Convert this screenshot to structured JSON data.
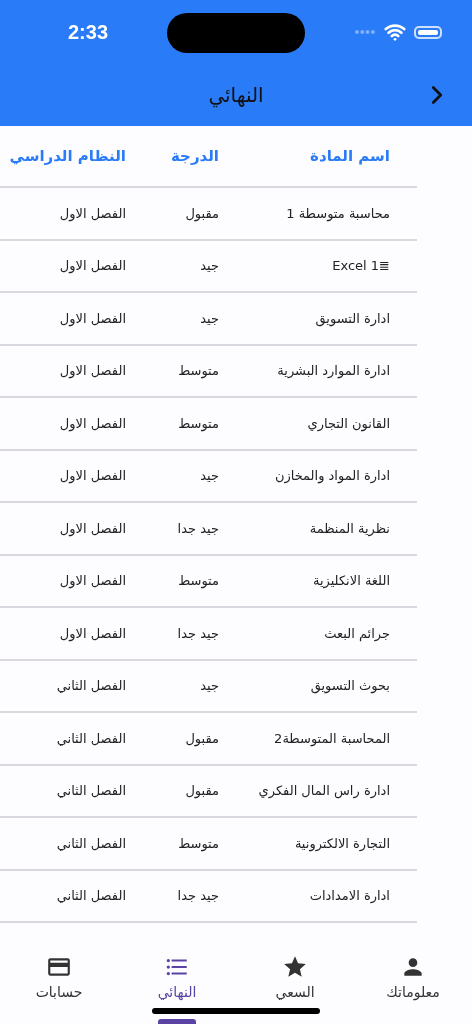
{
  "status_bar": {
    "time": "2:33"
  },
  "nav_bar": {
    "title": "النهائي"
  },
  "table": {
    "columns": [
      "اسم المادة",
      "الدرجة",
      "النظام الدراسي"
    ],
    "rows": [
      [
        "محاسبة متوسطة 1",
        "مقبول",
        "الفصل الاول"
      ],
      [
        "≣Excel 1",
        "جيد",
        "الفصل الاول"
      ],
      [
        "ادارة التسويق",
        "جيد",
        "الفصل الاول"
      ],
      [
        "ادارة الموارد البشرية",
        "متوسط",
        "الفصل الاول"
      ],
      [
        "القانون التجاري",
        "متوسط",
        "الفصل الاول"
      ],
      [
        "ادارة المواد والمخازن",
        "جيد",
        "الفصل الاول"
      ],
      [
        "نظرية المنظمة",
        "جيد جدا",
        "الفصل الاول"
      ],
      [
        "اللغة الانكليزية",
        "متوسط",
        "الفصل الاول"
      ],
      [
        "جرائم البعث",
        "جيد جدا",
        "الفصل الاول"
      ],
      [
        "بحوث التسويق",
        "جيد",
        "الفصل الثاني"
      ],
      [
        "المحاسبة المتوسطة2",
        "مقبول",
        "الفصل الثاني"
      ],
      [
        "ادارة راس المال الفكري",
        "مقبول",
        "الفصل الثاني"
      ],
      [
        "التجارة الالكترونية",
        "متوسط",
        "الفصل الثاني"
      ],
      [
        "ادارة الامدادات",
        "جيد جدا",
        "الفصل الثاني"
      ]
    ]
  },
  "tab_bar": [
    {
      "label": "معلوماتك",
      "selected": false
    },
    {
      "label": "السعي",
      "selected": false
    },
    {
      "label": "النهائي",
      "selected": true
    },
    {
      "label": "حسابات",
      "selected": false
    }
  ]
}
